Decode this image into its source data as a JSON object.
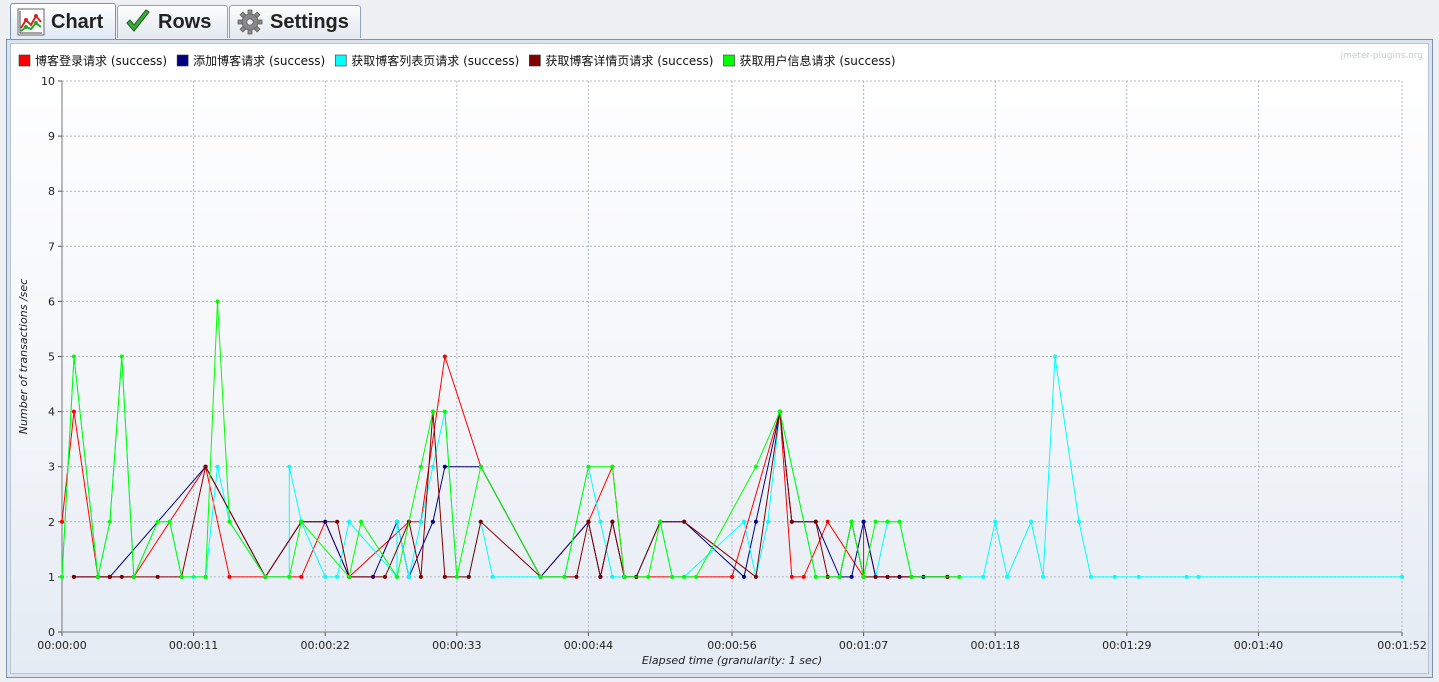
{
  "tabs": [
    {
      "label": "Chart",
      "icon": "line-chart-icon",
      "active": true
    },
    {
      "label": "Rows",
      "icon": "checkmark-icon",
      "active": false
    },
    {
      "label": "Settings",
      "icon": "gear-icon",
      "active": false
    }
  ],
  "watermark": "jmeter-plugins.org",
  "chart_data": {
    "type": "line",
    "xlabel": "Elapsed time (granularity: 1 sec)",
    "ylabel": "Number of transactions /sec",
    "xlim": [
      0,
      112
    ],
    "ylim": [
      0,
      10
    ],
    "x_ticks": [
      0,
      11,
      22,
      33,
      44,
      56,
      67,
      78,
      89,
      100,
      112
    ],
    "x_tick_labels": [
      "00:00:00",
      "00:00:11",
      "00:00:22",
      "00:00:33",
      "00:00:44",
      "00:00:56",
      "00:01:07",
      "00:01:18",
      "00:01:29",
      "00:01:40",
      "00:01:52"
    ],
    "y_ticks": [
      0,
      1,
      2,
      3,
      4,
      5,
      6,
      7,
      8,
      9,
      10
    ],
    "grid": true,
    "legend_position": "top-left",
    "series": [
      {
        "name": "博客登录请求 (success)",
        "color": "#ff0000",
        "points": [
          [
            0,
            2
          ],
          [
            1,
            4
          ],
          [
            3,
            1
          ],
          [
            4,
            1
          ],
          [
            6,
            1
          ],
          [
            12,
            3
          ],
          [
            14,
            1
          ],
          [
            20,
            1
          ],
          [
            22,
            2
          ],
          [
            24,
            1
          ],
          [
            29,
            2
          ],
          [
            30,
            2
          ],
          [
            32,
            5
          ],
          [
            35,
            3
          ],
          [
            40,
            1
          ],
          [
            44,
            2
          ],
          [
            46,
            3
          ],
          [
            47,
            1
          ],
          [
            56,
            1
          ],
          [
            60,
            4
          ],
          [
            61,
            1
          ],
          [
            62,
            1
          ],
          [
            64,
            2
          ],
          [
            67,
            1
          ],
          [
            67,
            2
          ],
          [
            68,
            1
          ],
          [
            69,
            1
          ],
          [
            70,
            1
          ],
          [
            71,
            1
          ],
          [
            75,
            1
          ]
        ]
      },
      {
        "name": "添加博客请求 (success)",
        "color": "#000080",
        "points": [
          [
            1,
            1
          ],
          [
            3,
            1
          ],
          [
            4,
            1
          ],
          [
            12,
            3
          ],
          [
            17,
            1
          ],
          [
            20,
            2
          ],
          [
            22,
            2
          ],
          [
            24,
            1
          ],
          [
            26,
            1
          ],
          [
            28,
            2
          ],
          [
            29,
            1
          ],
          [
            31,
            2
          ],
          [
            32,
            3
          ],
          [
            35,
            3
          ],
          [
            40,
            1
          ],
          [
            44,
            2
          ],
          [
            45,
            1
          ],
          [
            46,
            2
          ],
          [
            47,
            1
          ],
          [
            48,
            1
          ],
          [
            50,
            2
          ],
          [
            52,
            2
          ],
          [
            57,
            1
          ],
          [
            58,
            2
          ],
          [
            60,
            4
          ],
          [
            61,
            2
          ],
          [
            63,
            2
          ],
          [
            65,
            1
          ],
          [
            66,
            1
          ],
          [
            67,
            2
          ],
          [
            68,
            1
          ],
          [
            69,
            1
          ],
          [
            70,
            1
          ],
          [
            72,
            1
          ],
          [
            74,
            1
          ]
        ]
      },
      {
        "name": "获取博客列表页请求 (success)",
        "color": "#00ffff",
        "points": [
          [
            0,
            1
          ],
          [
            1,
            5
          ],
          [
            3,
            1
          ],
          [
            4,
            2
          ],
          [
            5,
            5
          ],
          [
            6,
            1
          ],
          [
            8,
            2
          ],
          [
            9,
            2
          ],
          [
            10,
            1
          ],
          [
            11,
            1
          ],
          [
            12,
            1
          ],
          [
            13,
            3
          ],
          [
            14,
            2
          ],
          [
            17,
            1
          ],
          [
            19,
            1
          ],
          [
            19,
            3
          ],
          [
            20,
            2
          ],
          [
            22,
            1
          ],
          [
            23,
            1
          ],
          [
            24,
            2
          ],
          [
            28,
            1
          ],
          [
            28,
            2
          ],
          [
            29,
            1
          ],
          [
            30,
            2
          ],
          [
            31,
            3
          ],
          [
            32,
            4
          ],
          [
            33,
            1
          ],
          [
            34,
            1
          ],
          [
            35,
            2
          ],
          [
            36,
            1
          ],
          [
            40,
            1
          ],
          [
            42,
            1
          ],
          [
            44,
            3
          ],
          [
            45,
            2
          ],
          [
            46,
            1
          ],
          [
            47,
            1
          ],
          [
            48,
            1
          ],
          [
            50,
            2
          ],
          [
            51,
            1
          ],
          [
            52,
            1
          ],
          [
            57,
            2
          ],
          [
            58,
            1
          ],
          [
            59,
            2
          ],
          [
            60,
            4
          ],
          [
            63,
            1
          ],
          [
            64,
            1
          ],
          [
            65,
            1
          ],
          [
            66,
            2
          ],
          [
            67,
            1
          ],
          [
            68,
            1
          ],
          [
            69,
            2
          ],
          [
            70,
            2
          ],
          [
            71,
            1
          ],
          [
            75,
            1
          ],
          [
            77,
            1
          ],
          [
            78,
            2
          ],
          [
            79,
            1
          ],
          [
            81,
            2
          ],
          [
            82,
            1
          ],
          [
            83,
            5
          ],
          [
            85,
            2
          ],
          [
            86,
            1
          ],
          [
            88,
            1
          ],
          [
            90,
            1
          ],
          [
            94,
            1
          ],
          [
            95,
            1
          ],
          [
            112,
            1
          ]
        ]
      },
      {
        "name": "获取博客详情页请求 (success)",
        "color": "#800000",
        "points": [
          [
            1,
            1
          ],
          [
            3,
            1
          ],
          [
            4,
            1
          ],
          [
            5,
            1
          ],
          [
            6,
            1
          ],
          [
            8,
            1
          ],
          [
            10,
            1
          ],
          [
            12,
            3
          ],
          [
            17,
            1
          ],
          [
            20,
            2
          ],
          [
            23,
            2
          ],
          [
            24,
            1
          ],
          [
            27,
            1
          ],
          [
            29,
            2
          ],
          [
            30,
            1
          ],
          [
            31,
            4
          ],
          [
            32,
            1
          ],
          [
            34,
            1
          ],
          [
            35,
            2
          ],
          [
            40,
            1
          ],
          [
            43,
            1
          ],
          [
            44,
            2
          ],
          [
            45,
            1
          ],
          [
            46,
            2
          ],
          [
            47,
            1
          ],
          [
            48,
            1
          ],
          [
            50,
            2
          ],
          [
            52,
            2
          ],
          [
            58,
            1
          ],
          [
            60,
            4
          ],
          [
            61,
            2
          ],
          [
            63,
            2
          ],
          [
            64,
            1
          ],
          [
            65,
            1
          ],
          [
            66,
            2
          ],
          [
            67,
            1
          ],
          [
            68,
            1
          ],
          [
            69,
            1
          ],
          [
            71,
            1
          ],
          [
            74,
            1
          ]
        ]
      },
      {
        "name": "获取用户信息请求 (success)",
        "color": "#00ff00",
        "points": [
          [
            0,
            1
          ],
          [
            1,
            5
          ],
          [
            3,
            1
          ],
          [
            4,
            2
          ],
          [
            5,
            5
          ],
          [
            6,
            1
          ],
          [
            8,
            2
          ],
          [
            9,
            2
          ],
          [
            10,
            1
          ],
          [
            12,
            1
          ],
          [
            13,
            6
          ],
          [
            14,
            2
          ],
          [
            17,
            1
          ],
          [
            19,
            1
          ],
          [
            20,
            2
          ],
          [
            24,
            1
          ],
          [
            25,
            2
          ],
          [
            28,
            1
          ],
          [
            30,
            3
          ],
          [
            31,
            4
          ],
          [
            32,
            4
          ],
          [
            33,
            1
          ],
          [
            35,
            3
          ],
          [
            40,
            1
          ],
          [
            42,
            1
          ],
          [
            44,
            3
          ],
          [
            46,
            3
          ],
          [
            47,
            1
          ],
          [
            49,
            1
          ],
          [
            50,
            2
          ],
          [
            51,
            1
          ],
          [
            52,
            1
          ],
          [
            53,
            1
          ],
          [
            58,
            3
          ],
          [
            60,
            4
          ],
          [
            63,
            1
          ],
          [
            65,
            1
          ],
          [
            66,
            2
          ],
          [
            67,
            1
          ],
          [
            68,
            2
          ],
          [
            69,
            2
          ],
          [
            70,
            2
          ],
          [
            71,
            1
          ],
          [
            75,
            1
          ]
        ]
      }
    ]
  }
}
